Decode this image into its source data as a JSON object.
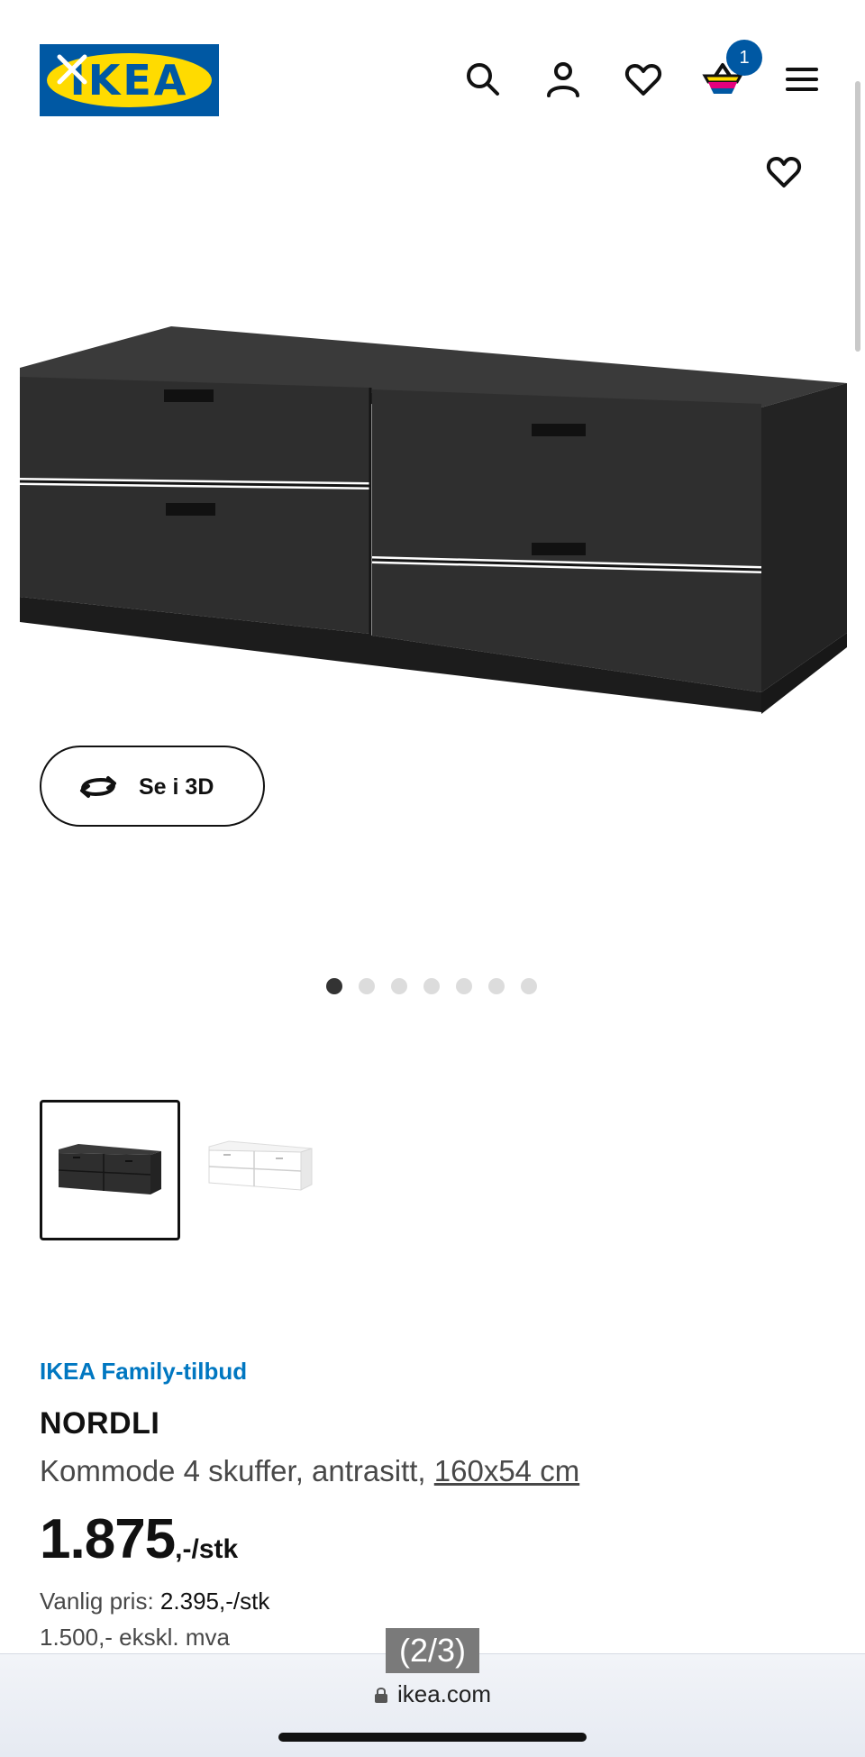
{
  "header": {
    "logo_text": "IKEA",
    "cart_count": "1",
    "icons": [
      "close-icon",
      "search-icon",
      "account-icon",
      "heart-icon",
      "cart-icon",
      "menu-icon"
    ]
  },
  "gallery": {
    "view_3d_label": "Se i 3D",
    "slide_count": 7,
    "active_slide": 1,
    "thumbnails": [
      "antrasitt",
      "hvit"
    ],
    "selected_thumbnail": 0
  },
  "product": {
    "tag": "IKEA Family-tilbud",
    "name": "NORDLI",
    "description": "Kommode 4 skuffer, antrasitt, ",
    "size": "160x54 cm",
    "price": "1.875",
    "price_suffix": ",-/stk",
    "regular_label": "Vanlig pris: ",
    "regular_price": "2.395,-/stk",
    "ex_vat": "1.500,- ekskl. mva"
  },
  "overlay": {
    "counter": "(2/3)"
  },
  "browser": {
    "url": "ikea.com"
  },
  "colors": {
    "ikea_blue": "#0058A3",
    "ikea_yellow": "#FFDB00",
    "family_blue": "#0077C1",
    "product_color": "#2a2a2a"
  }
}
